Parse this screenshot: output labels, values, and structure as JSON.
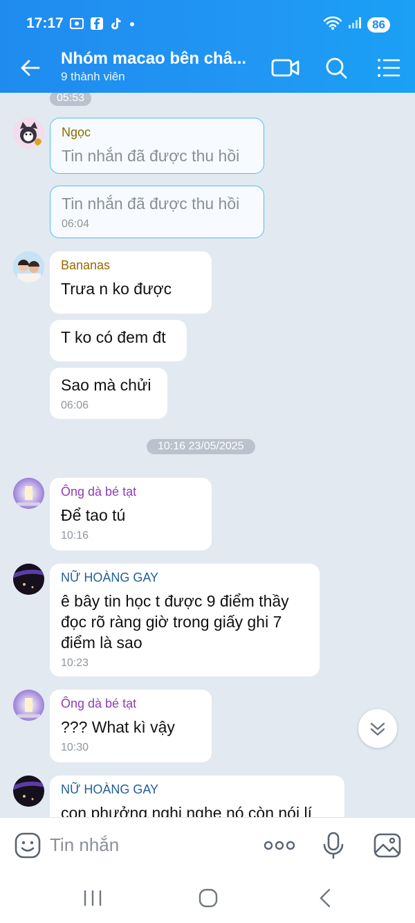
{
  "status": {
    "time": "17:17",
    "battery": "86"
  },
  "header": {
    "title": "Nhóm macao bên châ...",
    "subtitle": "9 thành viên"
  },
  "chat": {
    "top_time": "05:53",
    "date_divider": "10:16 23/05/2025",
    "messages": [
      {
        "sender": "Ngọc",
        "text": "Tin nhắn đã được thu hồi"
      },
      {
        "text": "Tin nhắn đã được thu hồi",
        "time": "06:04"
      },
      {
        "sender": "Bananas",
        "text": "Trưa n ko được"
      },
      {
        "text": "T ko có đem đt"
      },
      {
        "text": "Sao mà chửi",
        "time": "06:06"
      },
      {
        "sender": "Ông dà bé tạt",
        "text": "Để tao tú",
        "time": "10:16"
      },
      {
        "sender": "NỮ HOÀNG GAY",
        "text": "ê bây tin học t được 9 điểm thầy đọc rõ ràng giờ trong giấy ghi 7 điểm là sao",
        "time": "10:23"
      },
      {
        "sender": "Ông dà bé tạt",
        "text": "??? What kì vậy",
        "time": "10:30"
      },
      {
        "sender": "NỮ HOÀNG GAY",
        "text": "con phưởng nghi nghe nó còn nói lí"
      }
    ]
  },
  "input": {
    "placeholder": "Tin nhắn"
  },
  "colors": {
    "header": "#2196f3",
    "chat_bg": "#e2e9f1",
    "recalled_border": "#4ec3ea",
    "name_ngoc": "#8a6d00",
    "name_bananas": "#9a6700",
    "name_ong": "#8e3bb8",
    "name_nu": "#1f5f9a"
  }
}
